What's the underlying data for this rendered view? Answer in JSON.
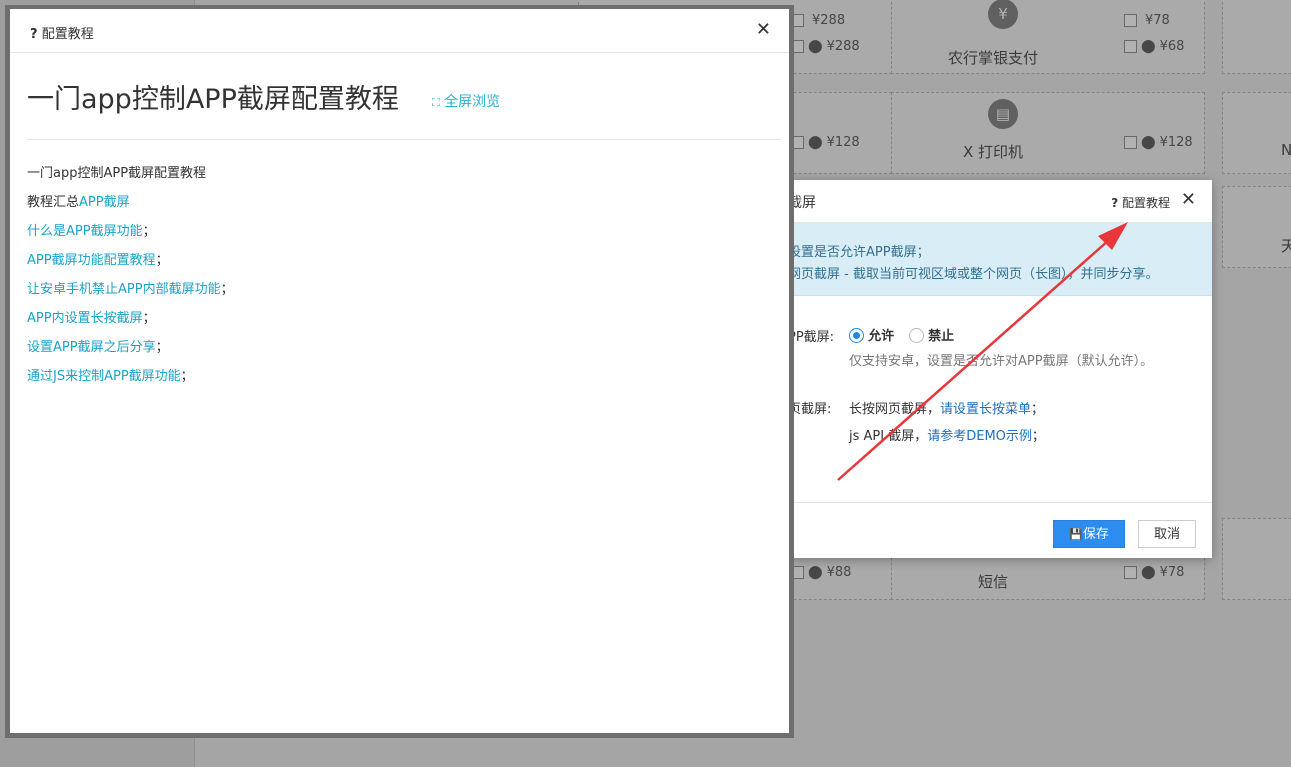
{
  "background": {
    "cards": [
      {
        "name": "",
        "apple_price": "¥288",
        "android_price": "¥288"
      },
      {
        "name": "农行掌银支付",
        "apple_price": "¥78",
        "android_price": "¥68"
      },
      {
        "name": "",
        "android_price": "¥128"
      },
      {
        "name": "X 打印机",
        "android_price": "¥128"
      },
      {
        "name": "",
        "android_price": "¥88"
      },
      {
        "name": "短信",
        "android_price": "¥78"
      }
    ],
    "edge_chars": [
      "N",
      "天"
    ]
  },
  "tutorial_dialog": {
    "header_title": "配置教程",
    "header_help_glyph": "?",
    "close_glyph": "✕",
    "heading": "一门app控制APP截屏配置教程",
    "fullscreen_label": "全屏浏览",
    "fullscreen_glyph": "⛶",
    "lines": [
      {
        "pre": "一门app控制APP截屏配置教程",
        "link": ""
      },
      {
        "pre": "教程汇总",
        "link": "APP截屏"
      },
      {
        "pre": "",
        "link": "什么是APP截屏功能",
        "post": "；"
      },
      {
        "pre": "",
        "link": "APP截屏功能配置教程",
        "post": "；"
      },
      {
        "pre": "",
        "link": "让安卓手机禁止APP内部截屏功能",
        "post": "；"
      },
      {
        "pre": "",
        "link": "APP内设置长按截屏",
        "post": "；"
      },
      {
        "pre": "",
        "link": "设置APP截屏之后分享",
        "post": "；"
      },
      {
        "pre": "",
        "link": "通过JS来控制APP截屏功能",
        "post": "；"
      }
    ]
  },
  "settings_dialog": {
    "title": "截屏",
    "help_label": "配置教程",
    "help_glyph": "?",
    "close_glyph": "✕",
    "info_line1": "设置是否允许APP截屏；",
    "info_line2": "网页截屏 - 截取当前可视区域或整个网页（长图），并同步分享。",
    "app_screenshot_label": "PP截屏:",
    "option_allow": "允许",
    "option_forbid": "禁止",
    "allow_hint": "仅支持安卓，设置是否允许对APP截屏（默认允许）。",
    "web_screenshot_label": "页截屏:",
    "web_line1_text": "长按网页截屏，",
    "web_line1_link": "请设置长按菜单",
    "web_line1_post": "；",
    "web_line2_text": "js API 截屏，",
    "web_line2_link": "请参考DEMO示例",
    "web_line2_post": "；",
    "save_label": "保存",
    "save_glyph": "💾",
    "cancel_label": "取消"
  },
  "colors": {
    "link": "#1aa3c9",
    "primary": "#2d8cf0",
    "arrow": "#e8373a"
  }
}
